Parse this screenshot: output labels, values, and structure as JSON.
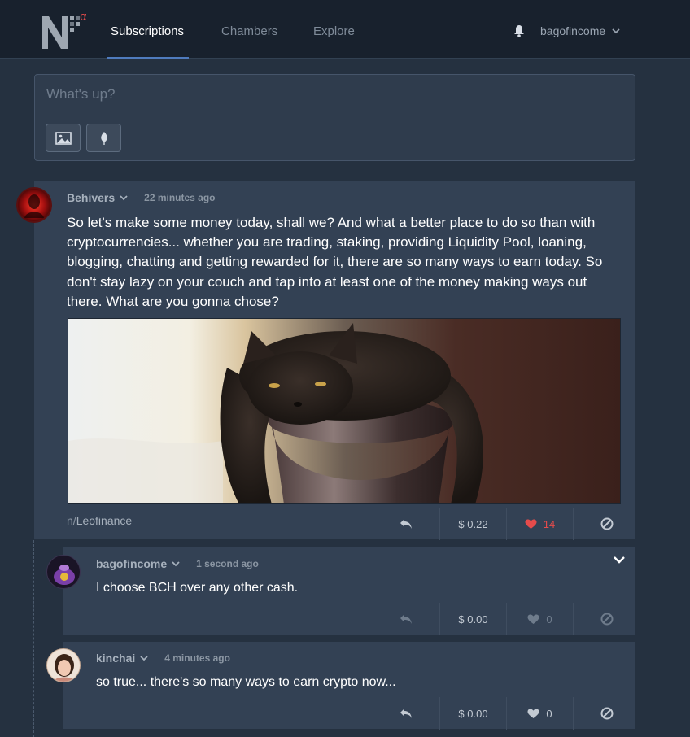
{
  "nav": {
    "logo_text": "N",
    "logo_badge": "α",
    "tabs": [
      {
        "label": "Subscriptions",
        "active": true
      },
      {
        "label": "Chambers",
        "active": false
      },
      {
        "label": "Explore",
        "active": false
      }
    ],
    "username": "bagofincome",
    "bell_icon": "bell-icon"
  },
  "composer": {
    "placeholder": "What's up?",
    "buttons": [
      "image-icon",
      "leaf-icon"
    ]
  },
  "post": {
    "author": "Behivers",
    "time": "22 minutes ago",
    "body": "So let's make some money today, shall we? And what a better place to do so than with cryptocurrencies... whether you are trading, staking, providing Liquidity Pool, loaning, blogging, chatting and getting rewarded for it, there are so many ways to earn today. So don't stay lazy on your couch and tap into at least one of the money making ways out there. What are you gonna chose?",
    "image_alt": "black cat resting on a chair",
    "community_prefix": "n/",
    "community": "Leofinance",
    "payout": "$ 0.22",
    "likes": "14"
  },
  "comments": [
    {
      "author": "bagofincome",
      "time": "1 second ago",
      "body": "I choose BCH over any other cash.",
      "payout": "$ 0.00",
      "likes": "0"
    },
    {
      "author": "kinchai",
      "time": "4 minutes ago",
      "body": "so true... there's so many ways to earn crypto now...",
      "payout": "$ 0.00",
      "likes": "0"
    }
  ],
  "colors": {
    "background": "#253140",
    "card": "#334154",
    "accent": "#4f7bbd",
    "like_active": "#e64b4b"
  }
}
